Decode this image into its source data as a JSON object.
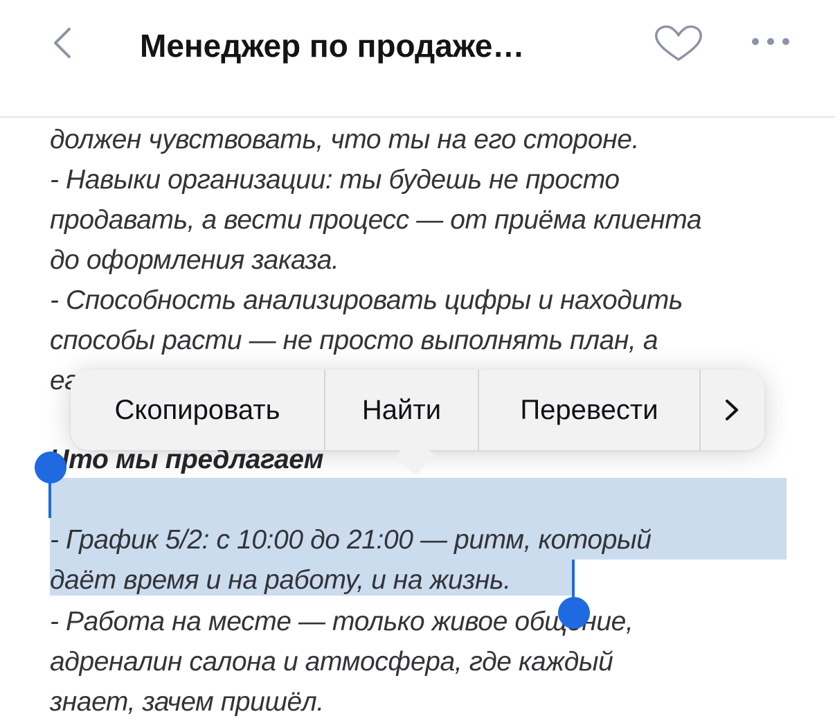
{
  "nav": {
    "title": "Менеджер по продаже…",
    "back_icon": "chevron-left-icon",
    "favorite_icon": "heart-outline-icon",
    "more_icon": "ellipsis-icon"
  },
  "content": {
    "lines": [
      "должен чувствовать, что ты на его стороне.",
      "- Навыки организации: ты будешь не просто",
      "продавать, а вести процесс — от приёма клиента",
      "до оформления заказа.",
      "- Способность анализировать цифры и находить",
      "способы расти — не просто выполнять план, а",
      "ег"
    ],
    "heading": "Что мы предлагаем",
    "lines_after": [
      "- График 5/2: с 10:00 до 21:00 — ритм, который",
      "даёт время и на работу, и на жизнь.",
      "- Работа на месте — только живое общение,",
      "адреналин салона и атмосфера, где каждый",
      "знает, зачем пришёл."
    ]
  },
  "edit_menu": {
    "copy_label": "Скопировать",
    "find_label": "Найти",
    "translate_label": "Перевести",
    "more_icon": "chevron-right-icon"
  },
  "colors": {
    "selection": "#cbdcef",
    "handle": "#1f6ae0",
    "icon_gray": "#8c93a6"
  }
}
